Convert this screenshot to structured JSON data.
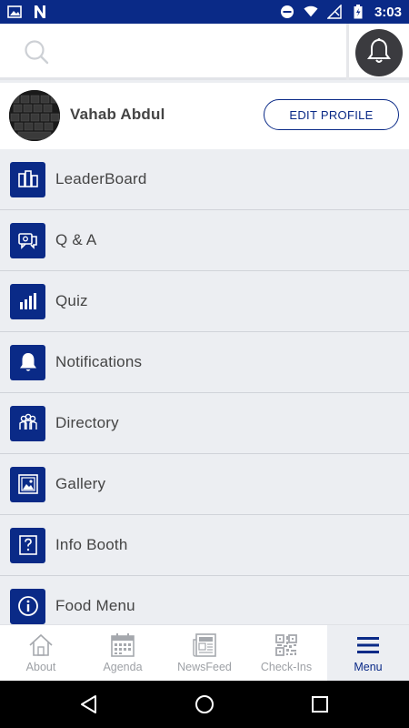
{
  "status_bar": {
    "time": "3:03"
  },
  "profile": {
    "name": "Vahab Abdul",
    "edit_label": "EDIT PROFILE"
  },
  "menu": {
    "items": [
      {
        "label": "LeaderBoard",
        "icon": "leaderboard-icon"
      },
      {
        "label": "Q & A",
        "icon": "qa-icon"
      },
      {
        "label": "Quiz",
        "icon": "quiz-icon"
      },
      {
        "label": "Notifications",
        "icon": "bell-icon"
      },
      {
        "label": "Directory",
        "icon": "directory-icon"
      },
      {
        "label": "Gallery",
        "icon": "gallery-icon"
      },
      {
        "label": "Info Booth",
        "icon": "info-booth-icon"
      },
      {
        "label": "Food Menu",
        "icon": "info-icon"
      }
    ]
  },
  "tabs": [
    {
      "label": "About",
      "icon": "home-icon",
      "active": false
    },
    {
      "label": "Agenda",
      "icon": "calendar-icon",
      "active": false
    },
    {
      "label": "NewsFeed",
      "icon": "newspaper-icon",
      "active": false
    },
    {
      "label": "Check-Ins",
      "icon": "qr-code-icon",
      "active": false
    },
    {
      "label": "Menu",
      "icon": "hamburger-icon",
      "active": true
    }
  ],
  "colors": {
    "accent": "#0a2a87",
    "background": "#eceef2",
    "tab_inactive": "#9ea1a6"
  }
}
